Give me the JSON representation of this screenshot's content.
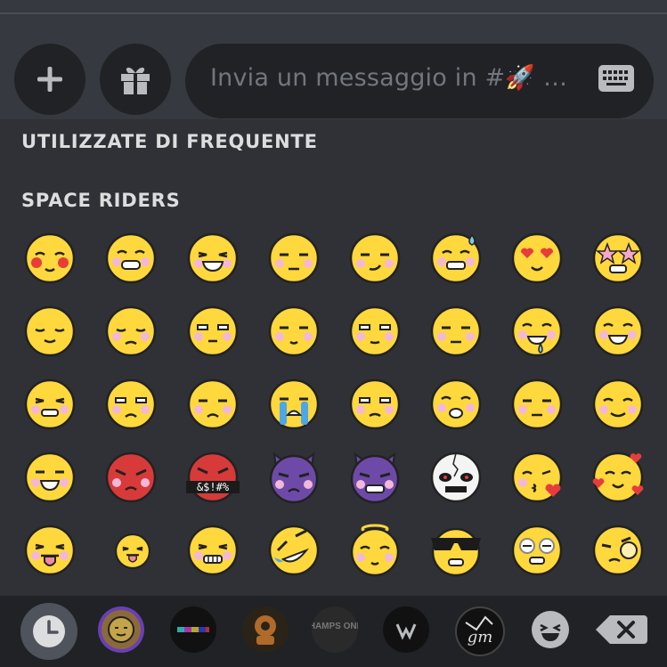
{
  "composer": {
    "placeholder": "Invia un messaggio in #🚀 …",
    "add_icon": "plus-icon",
    "gift_icon": "gift-icon",
    "keyboard_icon": "keyboard-icon"
  },
  "sections": [
    {
      "title": "UTILIZZATE DI FREQUENTE"
    },
    {
      "title": "SPACE RIDERS"
    }
  ],
  "censored_text": "&$!#%",
  "tabs": [
    {
      "icon": "clock-icon",
      "active": true
    },
    {
      "icon": "server-avatar-icon"
    },
    {
      "icon": "server-avatar-icon"
    },
    {
      "icon": "server-avatar-icon"
    },
    {
      "icon": "server-avatar-icon",
      "text": "CHAMPS ONLY"
    },
    {
      "icon": "server-avatar-icon"
    },
    {
      "icon": "server-avatar-icon",
      "text": "gm"
    },
    {
      "icon": "smiley-icon"
    },
    {
      "icon": "backspace-icon"
    }
  ],
  "colors": {
    "background": "#2f3136",
    "input_background": "#202225",
    "emoji_yellow": "#ffd83d",
    "emoji_red": "#d83a3a",
    "emoji_purple": "#6e4aa8"
  }
}
